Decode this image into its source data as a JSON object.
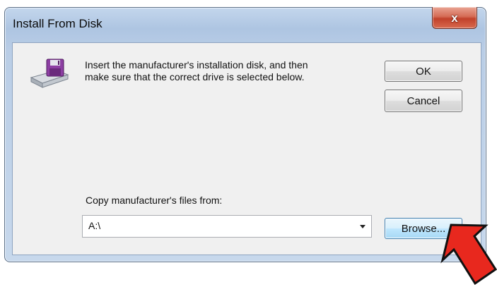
{
  "window": {
    "title": "Install From Disk",
    "close_glyph": "x",
    "close_icon": "close-icon"
  },
  "dialog": {
    "icon": "floppy-disk-drive-icon",
    "message_line1": "Insert the manufacturer's installation disk, and then",
    "message_line2": "make sure that the correct drive is selected below.",
    "ok_label": "OK",
    "cancel_label": "Cancel",
    "copy_label": "Copy manufacturer's files from:",
    "path_value": "A:\\",
    "browse_label": "Browse..."
  },
  "annotation": {
    "icon": "red-arrow-icon",
    "color": "#e8281e"
  },
  "colors": {
    "title_bar": "#b9cde6",
    "client_bg": "#f0f0f0",
    "close_button": "#c1412b",
    "focus_button": "#bee6fd"
  }
}
